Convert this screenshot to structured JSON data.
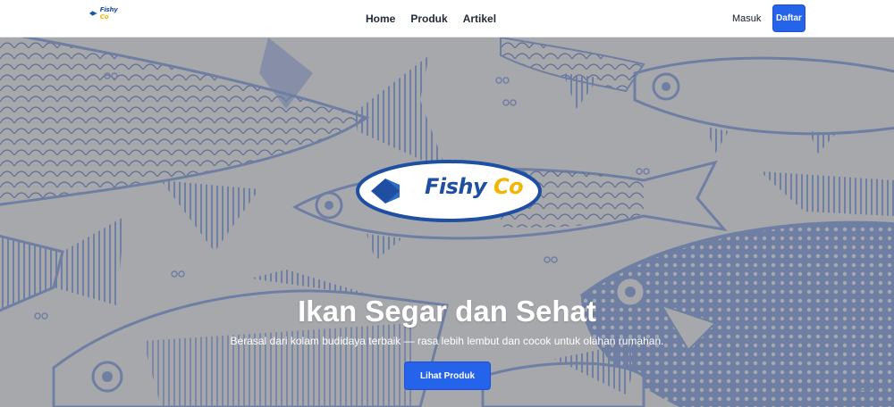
{
  "brand": {
    "name_part1": "Fishy",
    "name_part2": "Co"
  },
  "nav": {
    "links": [
      "Home",
      "Produk",
      "Artikel"
    ]
  },
  "auth": {
    "login_label": "Masuk",
    "signup_label": "Daftar"
  },
  "hero": {
    "logo_part1": "Fishy",
    "logo_part2": "Co",
    "title": "Ikan Segar dan Sehat",
    "subtitle": "Berasal dari kolam budidaya terbaik — rasa lebih lembut dan cocok untuk olahan rumahan.",
    "cta_label": "Lihat Produk"
  },
  "colors": {
    "primary": "#2563eb",
    "hero_background": "#a7a8ac",
    "fish_pattern": "#6f7fa3",
    "logo_blue": "#1e4fa3",
    "logo_yellow": "#f5b400"
  }
}
